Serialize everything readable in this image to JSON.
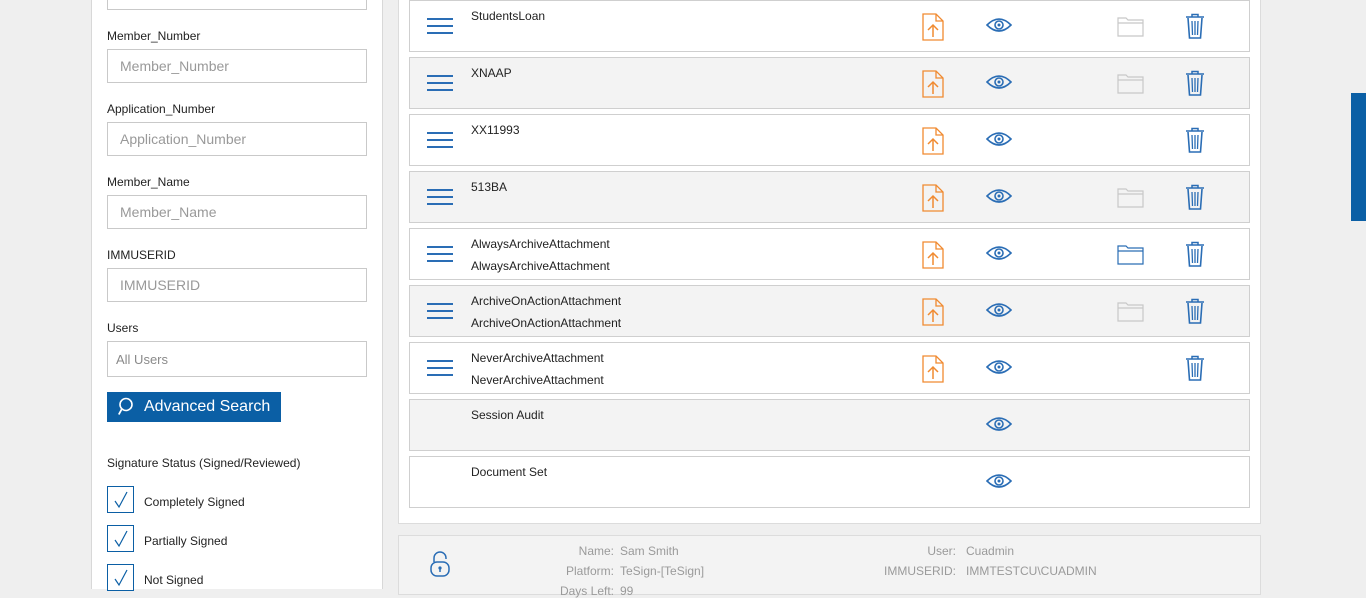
{
  "sidebar": {
    "fields": [
      {
        "label": "Member_Number",
        "placeholder": "Member_Number"
      },
      {
        "label": "Application_Number",
        "placeholder": "Application_Number"
      },
      {
        "label": "Member_Name",
        "placeholder": "Member_Name"
      },
      {
        "label": "IMMUSERID",
        "placeholder": "IMMUSERID"
      }
    ],
    "users_label": "Users",
    "users_value": "All Users",
    "advanced_search_label": "Advanced Search",
    "signature_status_title": "Signature Status (Signed/Reviewed)",
    "checkboxes": [
      {
        "label": "Completely Signed",
        "checked": true
      },
      {
        "label": "Partially Signed",
        "checked": true
      },
      {
        "label": "Not Signed",
        "checked": true
      }
    ]
  },
  "documents": [
    {
      "title": "StudentsLoan",
      "subtitle": "",
      "menu": true,
      "upload": true,
      "view": true,
      "folder": "disabled",
      "delete": true
    },
    {
      "title": "XNAAP",
      "subtitle": "",
      "menu": true,
      "upload": true,
      "view": true,
      "folder": "disabled",
      "delete": true
    },
    {
      "title": "XX11993",
      "subtitle": "",
      "menu": true,
      "upload": true,
      "view": true,
      "folder": "none",
      "delete": true
    },
    {
      "title": "513BA",
      "subtitle": "",
      "menu": true,
      "upload": true,
      "view": true,
      "folder": "disabled",
      "delete": true
    },
    {
      "title": "AlwaysArchiveAttachment",
      "subtitle": "AlwaysArchiveAttachment",
      "menu": true,
      "upload": true,
      "view": true,
      "folder": "active",
      "delete": true
    },
    {
      "title": "ArchiveOnActionAttachment",
      "subtitle": "ArchiveOnActionAttachment",
      "menu": true,
      "upload": true,
      "view": true,
      "folder": "disabled",
      "delete": true
    },
    {
      "title": "NeverArchiveAttachment",
      "subtitle": "NeverArchiveAttachment",
      "menu": true,
      "upload": true,
      "view": true,
      "folder": "none",
      "delete": true
    },
    {
      "title": "Session Audit",
      "subtitle": "",
      "menu": false,
      "upload": false,
      "view": true,
      "folder": "none",
      "delete": false
    },
    {
      "title": "Document Set",
      "subtitle": "",
      "menu": false,
      "upload": false,
      "view": true,
      "folder": "none",
      "delete": false
    }
  ],
  "footer": {
    "name_label": "Name:",
    "name_value": "Sam Smith",
    "platform_label": "Platform:",
    "platform_value": "TeSign-[TeSign]",
    "days_label": "Days Left:",
    "days_value": "99",
    "user_label": "User:",
    "user_value": "Cuadmin",
    "immuserid_label": "IMMUSERID:",
    "immuserid_value": "IMMTESTCU\\CUADMIN"
  },
  "colors": {
    "accent": "#0b5fa5",
    "upload": "#f08a30",
    "icon_blue": "#2a6db5",
    "disabled": "#c8c8c8"
  }
}
